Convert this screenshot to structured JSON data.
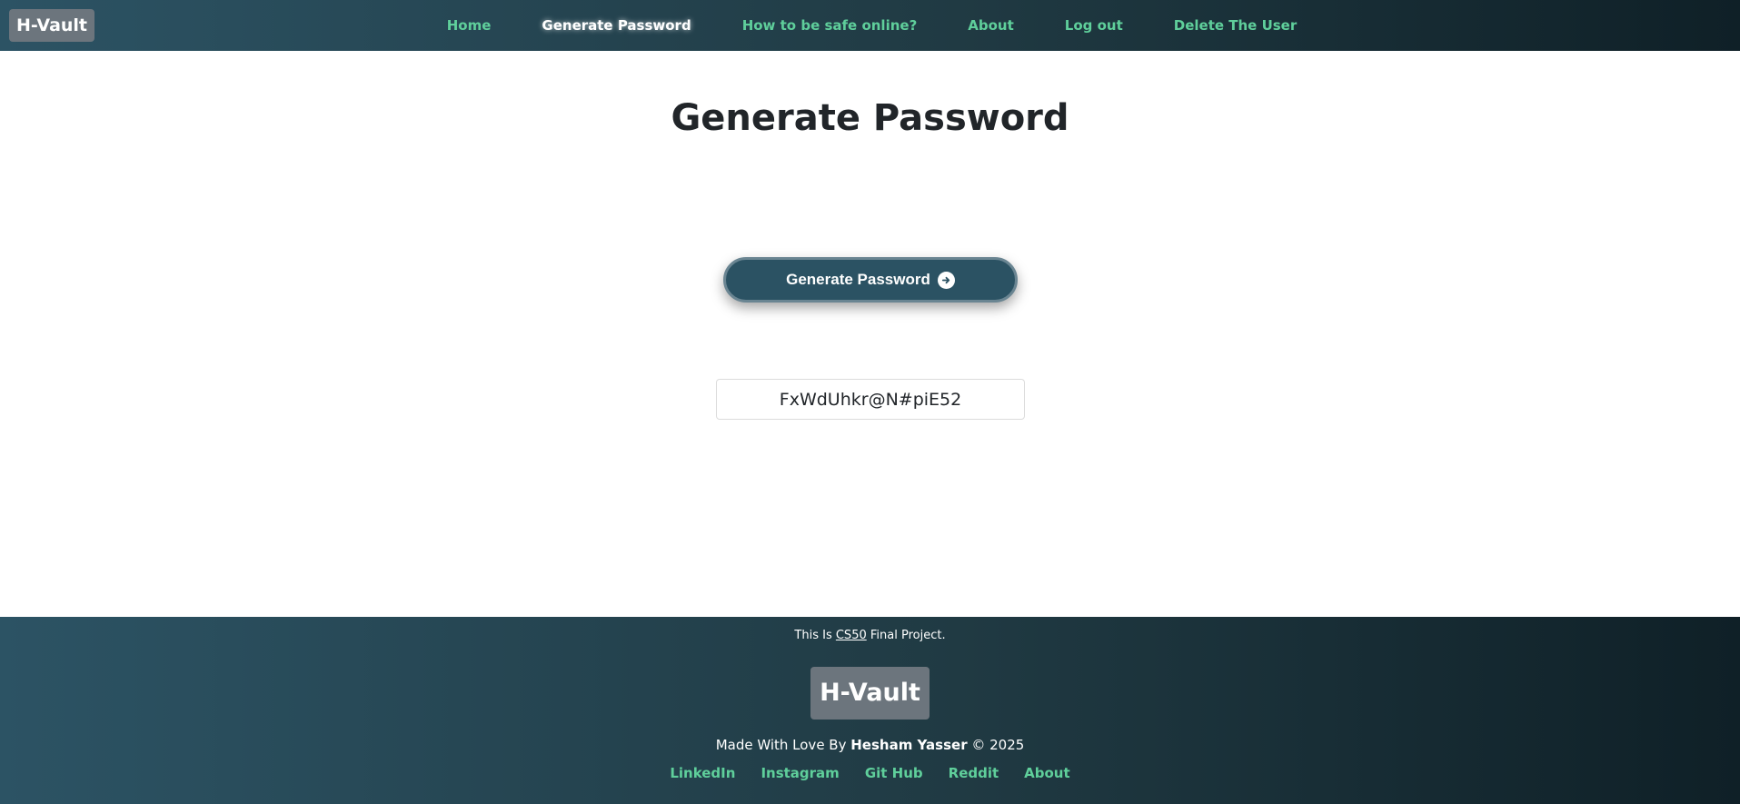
{
  "nav": {
    "brand": "H-Vault",
    "items": [
      {
        "label": "Home",
        "active": false
      },
      {
        "label": "Generate Password",
        "active": true
      },
      {
        "label": "How to be safe online?",
        "active": false
      },
      {
        "label": "About",
        "active": false
      },
      {
        "label": "Log out",
        "active": false
      },
      {
        "label": "Delete The User",
        "active": false
      }
    ]
  },
  "main": {
    "title": "Generate Password",
    "generate_button_label": "Generate Password",
    "generate_button_icon": "arrow-right-circle-icon",
    "password_value": "FxWdUhkr@N#piE52"
  },
  "footer": {
    "note_prefix": "This Is ",
    "note_link": "CS50",
    "note_suffix": " Final Project.",
    "brand": "H-Vault",
    "credit_prefix": "Made With Love By ",
    "credit_name": "Hesham Yasser",
    "credit_suffix": " © 2025",
    "links": [
      "LinkedIn",
      "Instagram",
      "Git Hub",
      "Reddit",
      "About"
    ]
  },
  "colors": {
    "gradient_start": "#2c5364",
    "gradient_end": "#0f2027",
    "nav_link": "#5fcf9b",
    "brand_bg": "#6c757d",
    "button_bg": "#2b5263"
  }
}
